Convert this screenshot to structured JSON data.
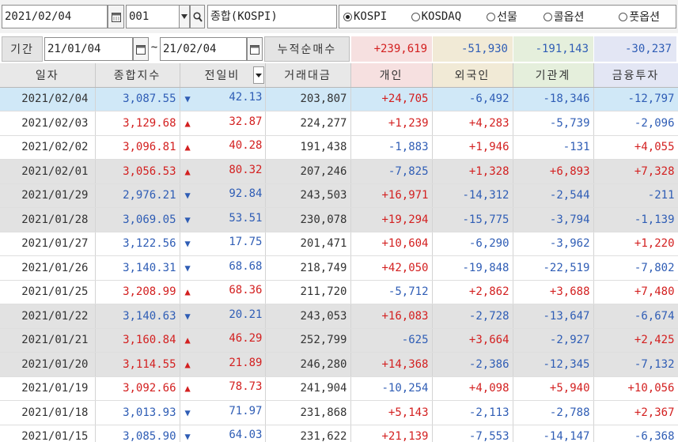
{
  "toolbar": {
    "date": "2021/02/04",
    "code": "001",
    "market_name": "종합(KOSPI)",
    "calendar_icon": "calendar-icon",
    "dropdown_icon": "dropdown-arrow-icon",
    "search_icon": "search-icon",
    "radios": [
      {
        "label": "KOSPI",
        "selected": true
      },
      {
        "label": "KOSDAQ",
        "selected": false
      },
      {
        "label": "선물",
        "selected": false
      },
      {
        "label": "콜옵션",
        "selected": false
      },
      {
        "label": "풋옵션",
        "selected": false
      }
    ]
  },
  "summary": {
    "period_label": "기간",
    "from_date": "21/01/04",
    "tilde": "~",
    "to_date": "21/02/04",
    "cum_label": "누적순매수",
    "individual": "+239,619",
    "foreign": "-51,930",
    "institution": "-191,143",
    "financial": "-30,237"
  },
  "colors": {
    "up": "#d32020",
    "down": "#2f5db5",
    "selected_row": "#d0e8f7",
    "gray_row": "#e2e2e2",
    "individual_bg": "#f6e0e0",
    "foreign_bg": "#f1ead6",
    "institution_bg": "#e5efdc",
    "financial_bg": "#e3e6f4"
  },
  "table": {
    "headers": [
      "일자",
      "종합지수",
      "전일비",
      "거래대금",
      "개인",
      "외국인",
      "기관계",
      "금융투자"
    ],
    "rows": [
      {
        "date": "2021/02/04",
        "index": "3,087.55",
        "dir": "down",
        "change": "42.13",
        "volume": "203,807",
        "individual": "+24,705",
        "foreign": "-6,492",
        "institution": "-18,346",
        "financial": "-12,797"
      },
      {
        "date": "2021/02/03",
        "index": "3,129.68",
        "dir": "up",
        "change": "32.87",
        "volume": "224,277",
        "individual": "+1,239",
        "foreign": "+4,283",
        "institution": "-5,739",
        "financial": "-2,096"
      },
      {
        "date": "2021/02/02",
        "index": "3,096.81",
        "dir": "up",
        "change": "40.28",
        "volume": "191,438",
        "individual": "-1,883",
        "foreign": "+1,946",
        "institution": "-131",
        "financial": "+4,055"
      },
      {
        "date": "2021/02/01",
        "index": "3,056.53",
        "dir": "up",
        "change": "80.32",
        "volume": "207,246",
        "individual": "-7,825",
        "foreign": "+1,328",
        "institution": "+6,893",
        "financial": "+7,328"
      },
      {
        "date": "2021/01/29",
        "index": "2,976.21",
        "dir": "down",
        "change": "92.84",
        "volume": "243,503",
        "individual": "+16,971",
        "foreign": "-14,312",
        "institution": "-2,544",
        "financial": "-211"
      },
      {
        "date": "2021/01/28",
        "index": "3,069.05",
        "dir": "down",
        "change": "53.51",
        "volume": "230,078",
        "individual": "+19,294",
        "foreign": "-15,775",
        "institution": "-3,794",
        "financial": "-1,139"
      },
      {
        "date": "2021/01/27",
        "index": "3,122.56",
        "dir": "down",
        "change": "17.75",
        "volume": "201,471",
        "individual": "+10,604",
        "foreign": "-6,290",
        "institution": "-3,962",
        "financial": "+1,220"
      },
      {
        "date": "2021/01/26",
        "index": "3,140.31",
        "dir": "down",
        "change": "68.68",
        "volume": "218,749",
        "individual": "+42,050",
        "foreign": "-19,848",
        "institution": "-22,519",
        "financial": "-7,802"
      },
      {
        "date": "2021/01/25",
        "index": "3,208.99",
        "dir": "up",
        "change": "68.36",
        "volume": "211,720",
        "individual": "-5,712",
        "foreign": "+2,862",
        "institution": "+3,688",
        "financial": "+7,480"
      },
      {
        "date": "2021/01/22",
        "index": "3,140.63",
        "dir": "down",
        "change": "20.21",
        "volume": "243,053",
        "individual": "+16,083",
        "foreign": "-2,728",
        "institution": "-13,647",
        "financial": "-6,674"
      },
      {
        "date": "2021/01/21",
        "index": "3,160.84",
        "dir": "up",
        "change": "46.29",
        "volume": "252,799",
        "individual": "-625",
        "foreign": "+3,664",
        "institution": "-2,927",
        "financial": "+2,425"
      },
      {
        "date": "2021/01/20",
        "index": "3,114.55",
        "dir": "up",
        "change": "21.89",
        "volume": "246,280",
        "individual": "+14,368",
        "foreign": "-2,386",
        "institution": "-12,345",
        "financial": "-7,132"
      },
      {
        "date": "2021/01/19",
        "index": "3,092.66",
        "dir": "up",
        "change": "78.73",
        "volume": "241,904",
        "individual": "-10,254",
        "foreign": "+4,098",
        "institution": "+5,940",
        "financial": "+10,056"
      },
      {
        "date": "2021/01/18",
        "index": "3,013.93",
        "dir": "down",
        "change": "71.97",
        "volume": "231,868",
        "individual": "+5,143",
        "foreign": "-2,113",
        "institution": "-2,788",
        "financial": "+2,367"
      },
      {
        "date": "2021/01/15",
        "index": "3,085.90",
        "dir": "down",
        "change": "64.03",
        "volume": "231,622",
        "individual": "+21,139",
        "foreign": "-7,553",
        "institution": "-14,147",
        "financial": "-6,368"
      }
    ]
  }
}
